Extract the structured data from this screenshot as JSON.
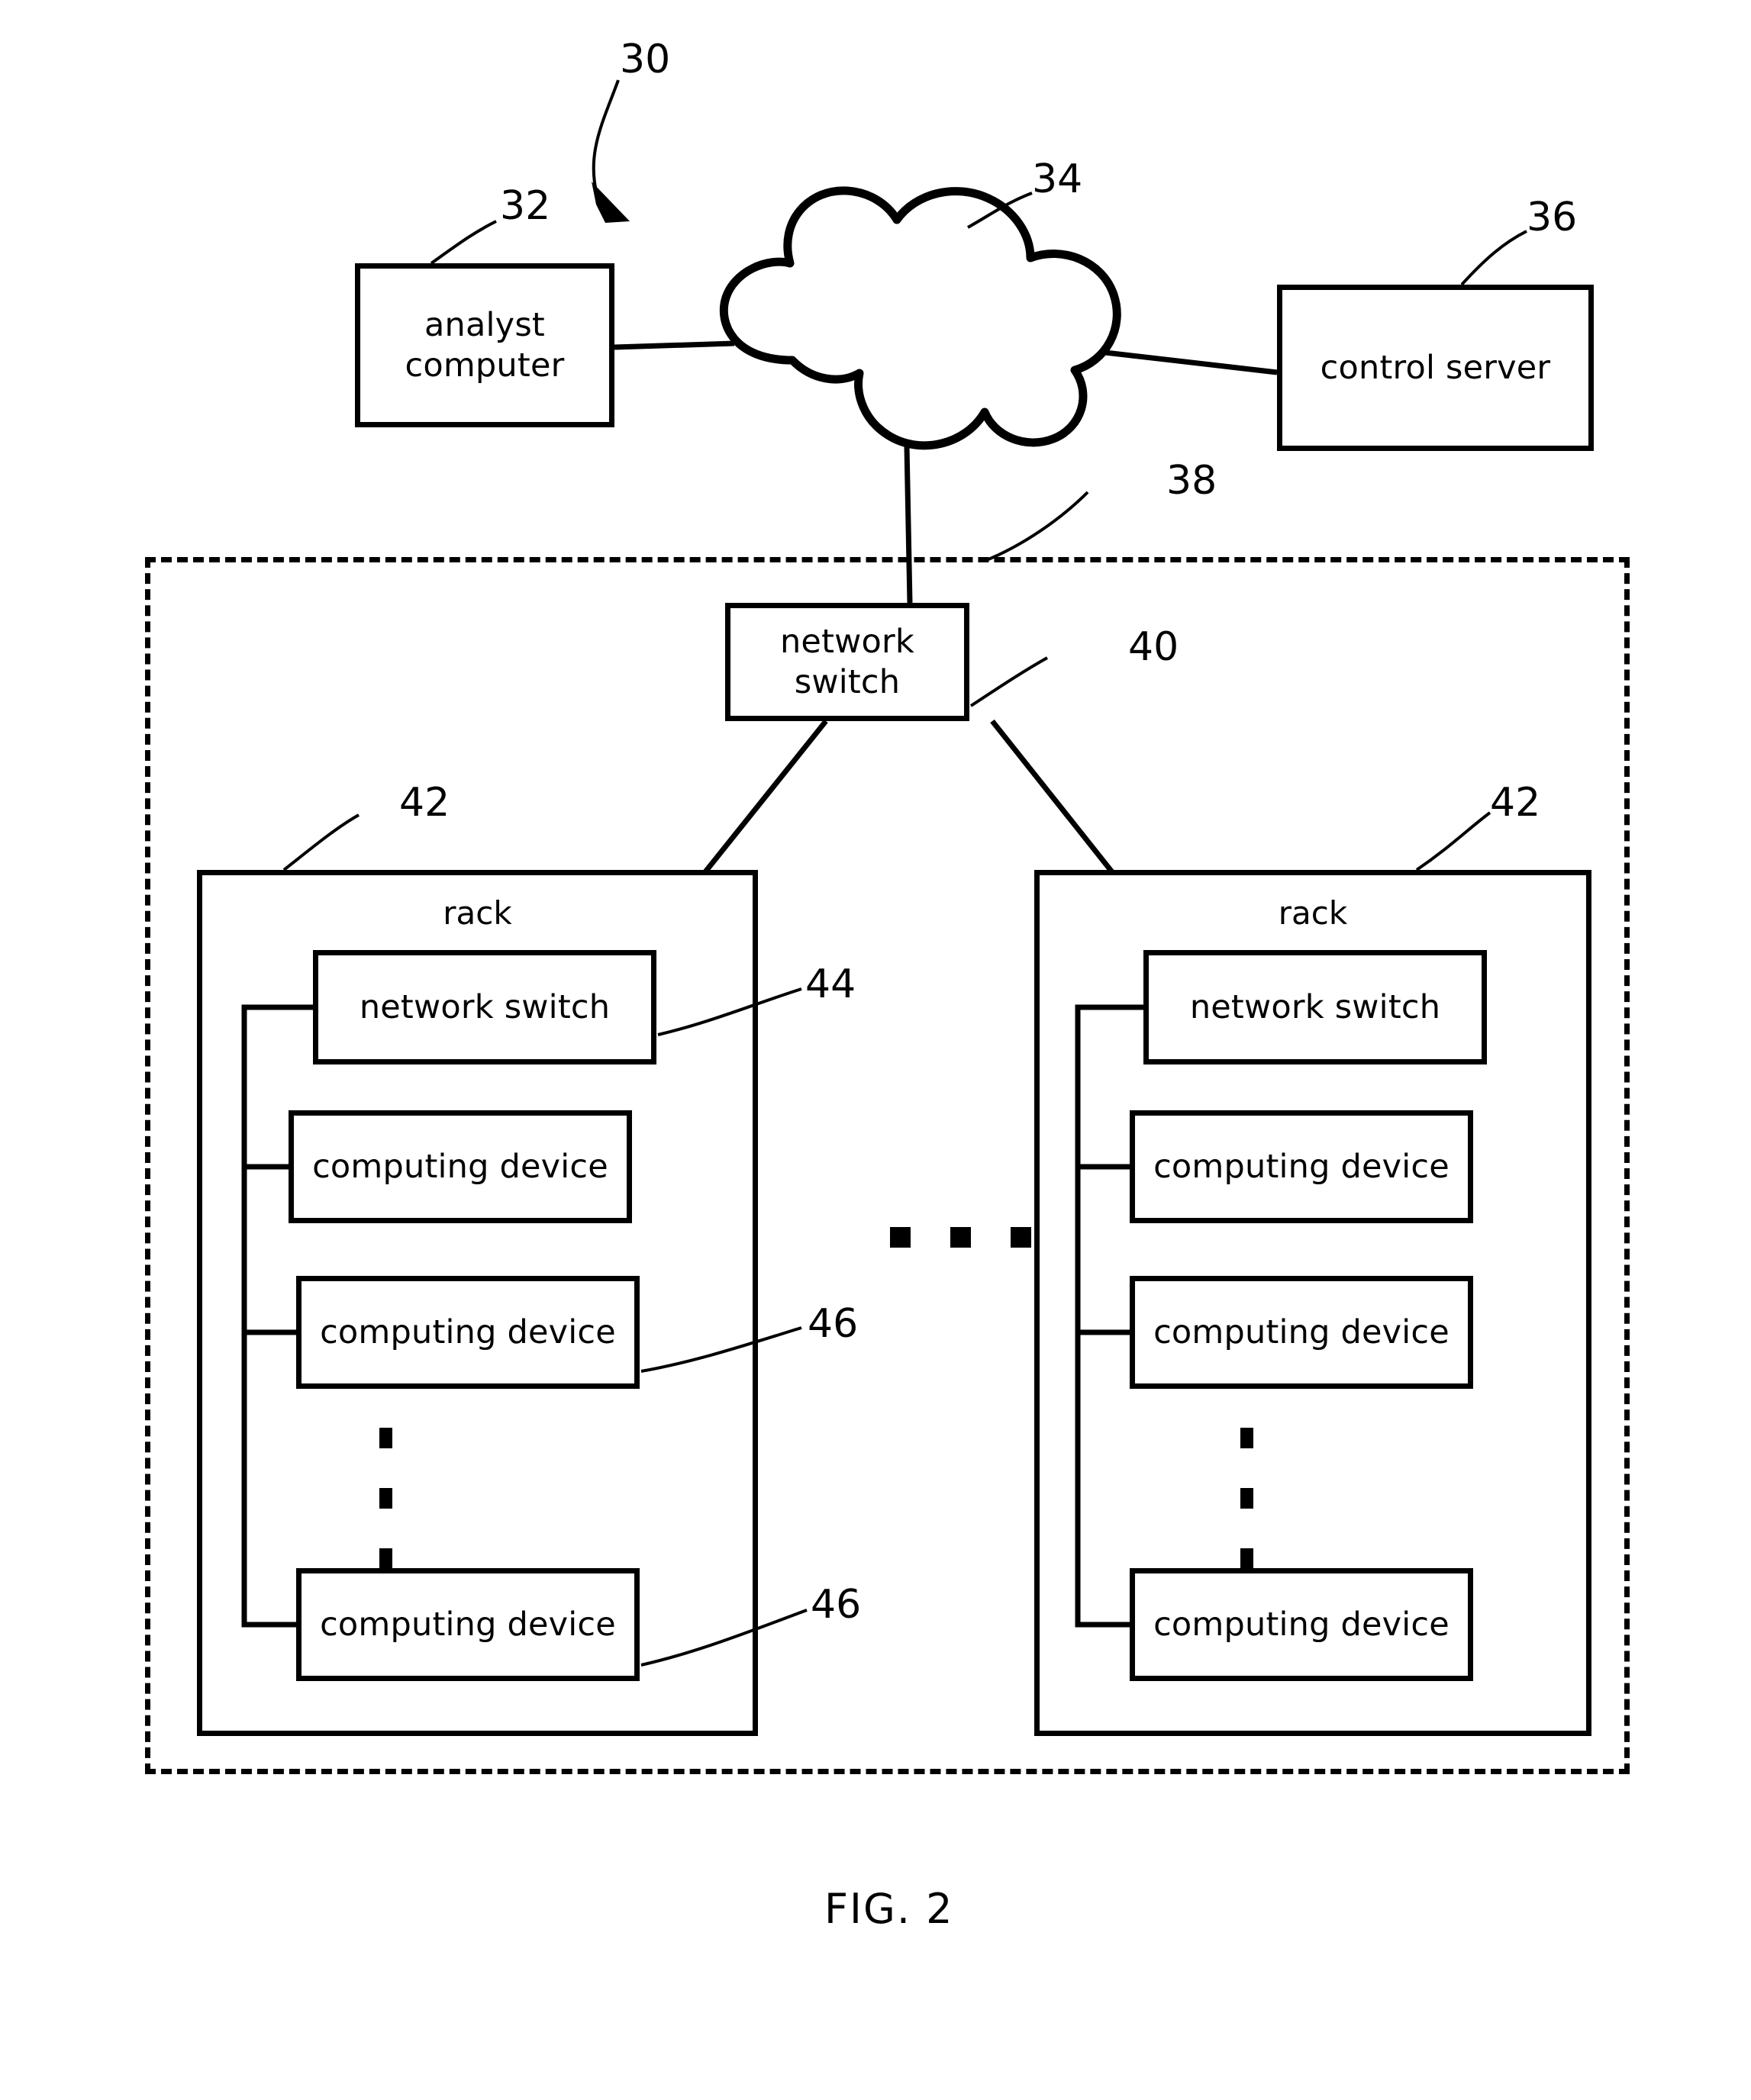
{
  "figure": {
    "caption": "FIG. 2",
    "system_ref": "30"
  },
  "nodes": {
    "analyst_computer": {
      "label": "analyst\ncomputer",
      "line1": "analyst",
      "line2": "computer",
      "ref": "32"
    },
    "network_cloud": {
      "label": "",
      "ref": "34"
    },
    "control_server": {
      "label": "control server",
      "ref": "36"
    },
    "datacenter_zone": {
      "label": "",
      "ref": "38"
    },
    "top_network_switch": {
      "label": "network switch",
      "ref": "40"
    }
  },
  "racks": [
    {
      "title": "rack",
      "ref": "42",
      "switch": {
        "label": "network switch",
        "ref": "44"
      },
      "devices": [
        {
          "label": "computing device",
          "ref": ""
        },
        {
          "label": "computing device",
          "ref": "46"
        },
        {
          "label": "computing device",
          "ref": "46"
        }
      ],
      "ellipsis": "vertical-three-dots"
    },
    {
      "title": "rack",
      "ref": "42",
      "switch": {
        "label": "network switch",
        "ref": ""
      },
      "devices": [
        {
          "label": "computing device",
          "ref": ""
        },
        {
          "label": "computing device",
          "ref": ""
        },
        {
          "label": "computing device",
          "ref": ""
        }
      ],
      "ellipsis": "vertical-three-dots"
    }
  ],
  "between_racks_ellipsis": "horizontal-three-dots",
  "colors": {
    "ink": "#000000",
    "paper": "#ffffff"
  }
}
